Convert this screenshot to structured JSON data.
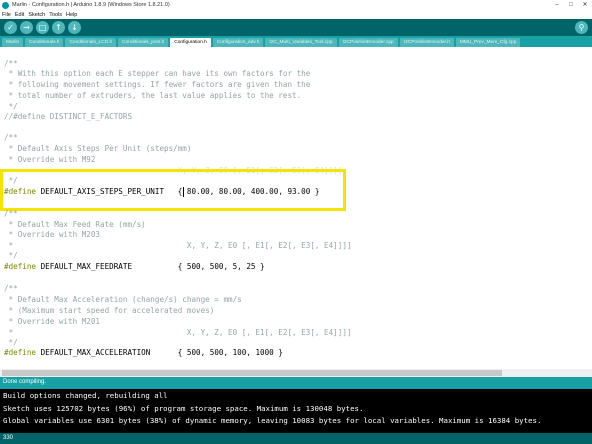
{
  "window": {
    "title": "Marlin - Configuration.h | Arduino 1.8.9 (Windows Store 1.8.21.0)"
  },
  "menu": [
    "File",
    "Edit",
    "Sketch",
    "Tools",
    "Help"
  ],
  "tabs": [
    {
      "label": "Marlin",
      "active": false
    },
    {
      "label": "Conditionals.h",
      "active": false
    },
    {
      "label": "Conditionals_LCD.h",
      "active": false
    },
    {
      "label": "Conditionals_post.h",
      "active": false
    },
    {
      "label": "Configuration.h",
      "active": true
    },
    {
      "label": "Configuration_adv.h",
      "active": false
    },
    {
      "label": "I2C_Multi_Variables_Tool.cpp",
      "active": false
    },
    {
      "label": "I2CPositionEncoder.cpp",
      "active": false
    },
    {
      "label": "I2CPositionEncoder.h",
      "active": false
    },
    {
      "label": "MMU_Prev_Mem_Cfg.cpp",
      "active": false
    }
  ],
  "code": {
    "l1": "/**",
    "l2": " * With this option each E stepper can have its own factors for the",
    "l3": " * following movement settings. If fewer factors are given than the",
    "l4": " * total number of extruders, the last value applies to the rest.",
    "l5": " */",
    "l6": "//#define DISTINCT_E_FACTORS",
    "l7": "/**",
    "l8": " * Default Axis Steps Per Unit (steps/mm)",
    "l9": " * Override with M92",
    "l10": "                                      X, Y, Z, E0 [, E1[, E2[, E3[, E4]]]]",
    "l11": " */",
    "d1_kw": "#define",
    "d1_name": " DEFAULT_AXIS_STEPS_PER_UNIT",
    "d1_val": "   { 80.00, 80.00, 400.00, 93.00 }",
    "l12": "/**",
    "l13": " * Default Max Feed Rate (mm/s)",
    "l14": " * Override with M203",
    "l15": " *                                      X, Y, Z, E0 [, E1[, E2[, E3[, E4]]]]",
    "l16": " */",
    "d2_kw": "#define",
    "d2_name": " DEFAULT_MAX_FEEDRATE",
    "d2_val": "          { 500, 500, 5, 25 }",
    "l17": "/**",
    "l18": " * Default Max Acceleration (change/s) change = mm/s",
    "l19": " * (Maximum start speed for accelerated moves)",
    "l20": " * Override with M201",
    "l21": " *                                      X, Y, Z, E0 [, E1[, E2[, E3[, E4]]]]",
    "l22": " */",
    "d3_kw": "#define",
    "d3_name": " DEFAULT_MAX_ACCELERATION",
    "d3_val": "      { 500, 500, 100, 1000 }"
  },
  "status": "Done compiling.",
  "console": [
    "Build options changed, rebuilding all",
    "Sketch uses 125702 bytes (96%) of program storage space. Maximum is 130048 bytes.",
    "Global variables use 6301 bytes (38%) of dynamic memory, leaving 10083 bytes for local variables. Maximum is 16384 bytes."
  ],
  "footer": "330",
  "colors": {
    "toolbar": "#006468",
    "tabbar": "#17a1a5",
    "highlight": "#f2e300",
    "keyword": "#728e00",
    "comment": "#95a5a6"
  },
  "icons": {
    "verify": "check-icon",
    "upload": "arrow-right-icon",
    "new": "new-file-icon",
    "open": "arrow-up-icon",
    "save": "arrow-down-icon",
    "monitor": "magnifier-icon"
  }
}
